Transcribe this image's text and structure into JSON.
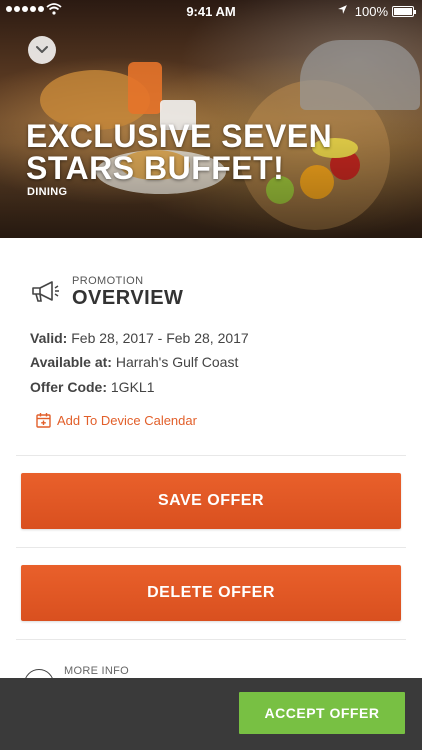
{
  "status_bar": {
    "time": "9:41 AM",
    "battery": "100%",
    "icons": [
      "signal-dots",
      "wifi-icon",
      "location-arrow-icon",
      "battery-icon"
    ]
  },
  "hero": {
    "title": "EXCLUSIVE SEVEN STARS BUFFET!",
    "category": "DINING",
    "collapse_icon": "chevron-down-icon"
  },
  "overview": {
    "eyebrow": "PROMOTION",
    "title": "OVERVIEW",
    "icon": "megaphone-icon",
    "valid_label": "Valid:",
    "valid_value": "Feb 28, 2017 - Feb 28, 2017",
    "available_label": "Available at:",
    "available_value": "Harrah's Gulf Coast",
    "code_label": "Offer Code:",
    "code_value": "1GKL1",
    "calendar_link": "Add To Device Calendar",
    "calendar_icon": "calendar-plus-icon"
  },
  "actions": {
    "save_label": "SAVE OFFER",
    "delete_label": "DELETE OFFER"
  },
  "more_info": {
    "label": "MORE INFO"
  },
  "bottom_bar": {
    "accept_label": "ACCEPT OFFER"
  },
  "colors": {
    "accent_orange": "#e25f2a",
    "accept_green": "#78c043",
    "bottom_bar": "#3a3a3a"
  }
}
